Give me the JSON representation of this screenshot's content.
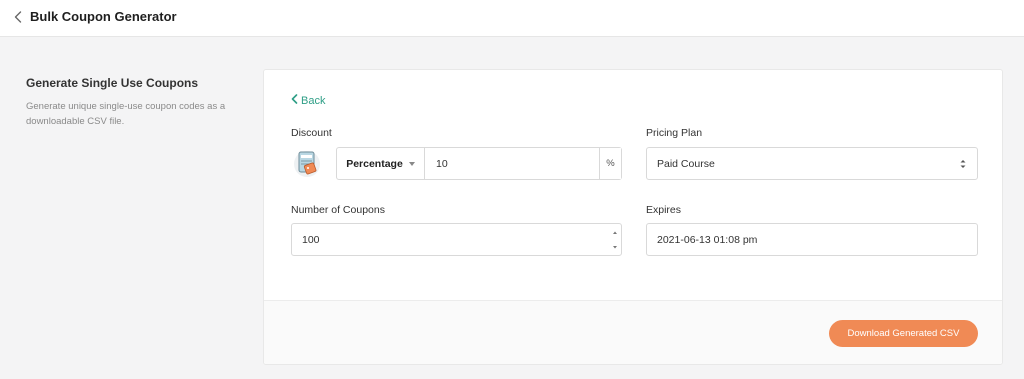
{
  "header": {
    "title": "Bulk Coupon Generator",
    "back_icon": "chevron-left-icon"
  },
  "sidebar": {
    "title": "Generate Single Use Coupons",
    "description": "Generate unique single-use coupon codes as a downloadable CSV file."
  },
  "form": {
    "back_label": "Back",
    "discount": {
      "label": "Discount",
      "icon": "coupon-icon",
      "type_selected": "Percentage",
      "value": "10",
      "suffix": "%"
    },
    "pricing_plan": {
      "label": "Pricing Plan",
      "selected": "Paid Course"
    },
    "number_of_coupons": {
      "label": "Number of Coupons",
      "value": "100"
    },
    "expires": {
      "label": "Expires",
      "value": "2021-06-13 01:08 pm"
    }
  },
  "footer": {
    "download_label": "Download Generated CSV"
  },
  "colors": {
    "accent_green": "#2e9e86",
    "button_orange": "#f08a55",
    "page_bg": "#f4f4f5"
  }
}
